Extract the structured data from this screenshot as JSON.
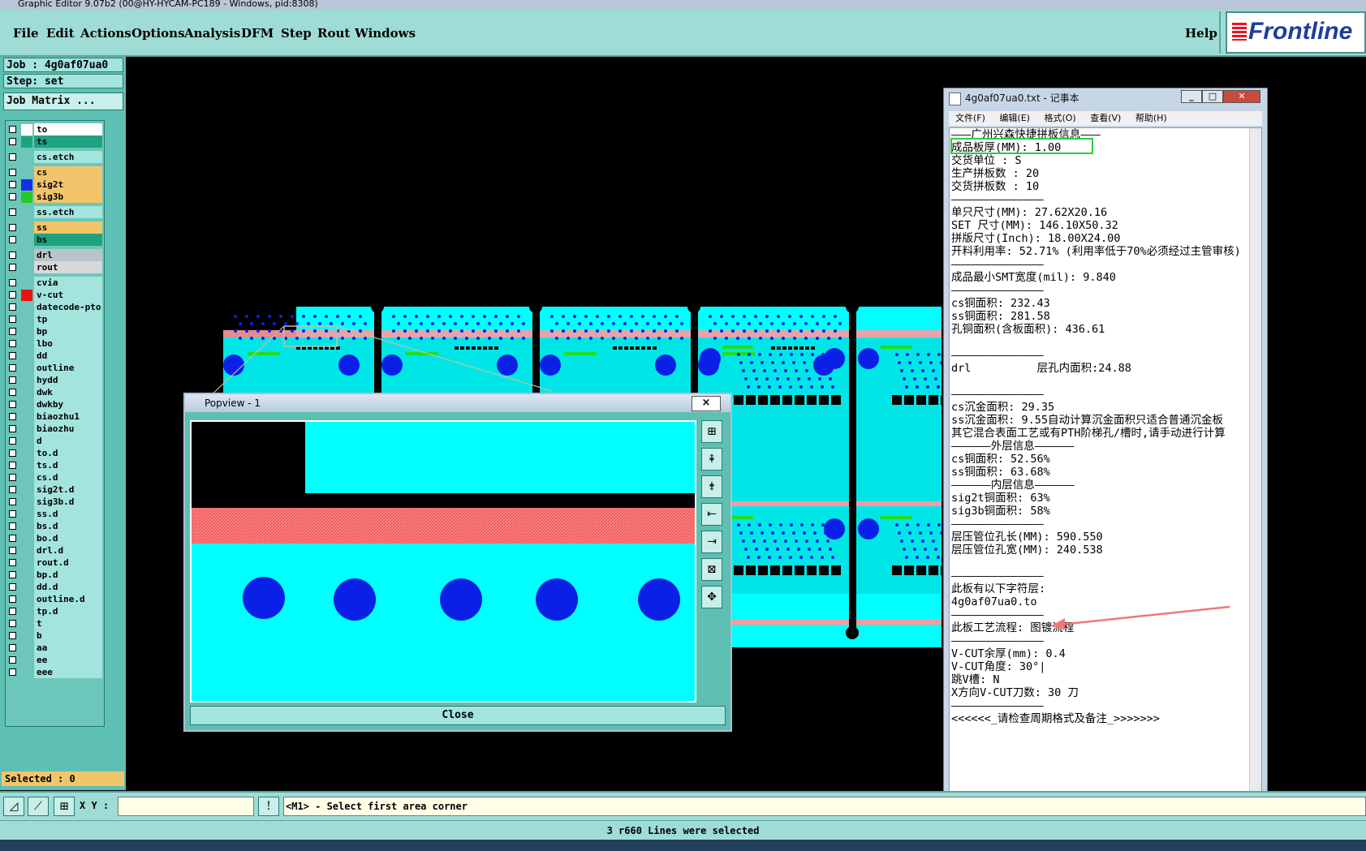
{
  "window_title": "Graphic Editor 9.07b2 (00@HY-HYCAM-PC189 - Windows, pid:8308)",
  "menu": [
    "File",
    "Edit",
    "Actions",
    "Options",
    "Analysis",
    "DFM",
    "Step",
    "Rout",
    "Windows"
  ],
  "help_label": "Help",
  "brand": "Frontline",
  "job_label": "Job : 4g0af07ua0",
  "step_label": "Step: set",
  "job_matrix_label": "Job Matrix ...",
  "layers": [
    {
      "name": "to",
      "color": "#ffffff",
      "bg": "#ffffff"
    },
    {
      "name": "ts",
      "color": "#1fa27e",
      "bg": "#1fa27e"
    },
    {
      "name": "cs.etch",
      "color": "",
      "bg": "#a3e4dd"
    },
    {
      "name": "cs",
      "color": "",
      "bg": "#f3c56a"
    },
    {
      "name": "sig2t",
      "color": "#1430e0",
      "bg": "#f3c56a"
    },
    {
      "name": "sig3b",
      "color": "#22cc22",
      "bg": "#f3c56a"
    },
    {
      "name": "ss.etch",
      "color": "",
      "bg": "#a3e4dd"
    },
    {
      "name": "ss",
      "color": "",
      "bg": "#f3c56a"
    },
    {
      "name": "bs",
      "color": "",
      "bg": "#1fa27e"
    },
    {
      "name": "drl",
      "color": "",
      "bg": "#b8c4c8"
    },
    {
      "name": "rout",
      "color": "",
      "bg": "#d8d8d8"
    },
    {
      "name": "cvia",
      "color": "",
      "bg": "#a3e4dd"
    },
    {
      "name": "v-cut",
      "color": "#ee1111",
      "bg": "#a3e4dd"
    },
    {
      "name": "datecode-pto",
      "color": "",
      "bg": "#a3e4dd"
    },
    {
      "name": "tp",
      "color": "",
      "bg": "#a3e4dd"
    },
    {
      "name": "bp",
      "color": "",
      "bg": "#a3e4dd"
    },
    {
      "name": "lbo",
      "color": "",
      "bg": "#a3e4dd"
    },
    {
      "name": "dd",
      "color": "",
      "bg": "#a3e4dd"
    },
    {
      "name": "outline",
      "color": "",
      "bg": "#a3e4dd"
    },
    {
      "name": "hydd",
      "color": "",
      "bg": "#a3e4dd"
    },
    {
      "name": "dwk",
      "color": "",
      "bg": "#a3e4dd"
    },
    {
      "name": "dwkby",
      "color": "",
      "bg": "#a3e4dd"
    },
    {
      "name": "biaozhu1",
      "color": "",
      "bg": "#a3e4dd"
    },
    {
      "name": "biaozhu",
      "color": "",
      "bg": "#a3e4dd"
    },
    {
      "name": "d",
      "color": "",
      "bg": "#a3e4dd"
    },
    {
      "name": "to.d",
      "color": "",
      "bg": "#a3e4dd"
    },
    {
      "name": "ts.d",
      "color": "",
      "bg": "#a3e4dd"
    },
    {
      "name": "cs.d",
      "color": "",
      "bg": "#a3e4dd"
    },
    {
      "name": "sig2t.d",
      "color": "",
      "bg": "#a3e4dd"
    },
    {
      "name": "sig3b.d",
      "color": "",
      "bg": "#a3e4dd"
    },
    {
      "name": "ss.d",
      "color": "",
      "bg": "#a3e4dd"
    },
    {
      "name": "bs.d",
      "color": "",
      "bg": "#a3e4dd"
    },
    {
      "name": "bo.d",
      "color": "",
      "bg": "#a3e4dd"
    },
    {
      "name": "drl.d",
      "color": "",
      "bg": "#a3e4dd"
    },
    {
      "name": "rout.d",
      "color": "",
      "bg": "#a3e4dd"
    },
    {
      "name": "bp.d",
      "color": "",
      "bg": "#a3e4dd"
    },
    {
      "name": "dd.d",
      "color": "",
      "bg": "#a3e4dd"
    },
    {
      "name": "outline.d",
      "color": "",
      "bg": "#a3e4dd"
    },
    {
      "name": "tp.d",
      "color": "",
      "bg": "#a3e4dd"
    },
    {
      "name": "t",
      "color": "",
      "bg": "#a3e4dd"
    },
    {
      "name": "b",
      "color": "",
      "bg": "#a3e4dd"
    },
    {
      "name": "aa",
      "color": "",
      "bg": "#a3e4dd"
    },
    {
      "name": "ee",
      "color": "",
      "bg": "#a3e4dd"
    },
    {
      "name": "eee",
      "color": "",
      "bg": "#a3e4dd"
    }
  ],
  "selected_label": "Selected : 0",
  "xy_label": "X Y :",
  "xy_value": "",
  "prompt": "<M1> - Select first area corner",
  "status": "3 r660 Lines were selected",
  "popview": {
    "title": "Popview - 1",
    "close_label": "Close",
    "close_x": "×"
  },
  "notepad": {
    "title": "4g0af07ua0.txt - 记事本",
    "menu": [
      "文件(F)",
      "编辑(E)",
      "格式(O)",
      "查看(V)",
      "帮助(H)"
    ],
    "lines": [
      "———广州兴森快捷拼板信息———",
      "成品板厚(MM): 1.00",
      "交货单位 : S",
      "生产拼板数 : 20",
      "交货拼板数 : 10",
      "——————————————",
      "单只尺寸(MM): 27.62X20.16",
      "SET 尺寸(MM): 146.10X50.32",
      "拼版尺寸(Inch): 18.00X24.00",
      "开料利用率: 52.71% (利用率低于70%必须经过主管审核)",
      "——————————————",
      "成品最小SMT宽度(mil): 9.840",
      "——————————————",
      "cs铜面积: 232.43",
      "ss铜面积: 281.58",
      "孔铜面积(含板面积): 436.61",
      "",
      "——————————————",
      "drl          层孔内面积:24.88",
      "",
      "——————————————",
      "cs沉金面积: 29.35",
      "ss沉金面积: 9.55自动计算沉金面积只适合普通沉金板",
      "其它混合表面工艺或有PTH阶梯孔/槽时,请手动进行计算",
      "——————外层信息——————",
      "cs铜面积: 52.56%",
      "ss铜面积: 63.68%",
      "——————内层信息——————",
      "sig2t铜面积: 63%",
      "sig3b铜面积: 58%",
      "——————————————",
      "层压管位孔长(MM): 590.550",
      "层压管位孔宽(MM): 240.538",
      "",
      "——————————————",
      "此板有以下字符层:",
      "4g0af07ua0.to",
      "——————————————",
      "此板工艺流程: 图镀流程",
      "——————————————",
      "V-CUT余厚(mm): 0.4",
      "V-CUT角度: 30°|",
      "跳V槽: N",
      "X方向V-CUT刀数: 30 刀",
      "——————————————",
      "<<<<<<_请检查周期格式及备注_>>>>>>>"
    ]
  }
}
